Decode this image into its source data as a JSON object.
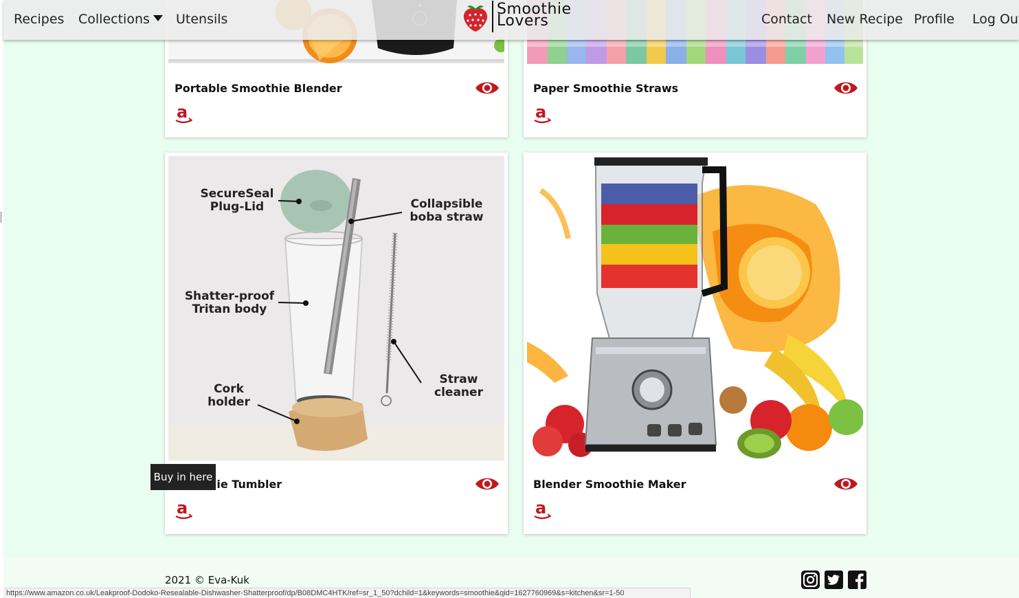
{
  "nav": {
    "left": [
      "Recipes",
      "Collections",
      "Utensils"
    ],
    "right": [
      "Contact",
      "New Recipe",
      "Profile",
      "Log Out"
    ]
  },
  "brand": {
    "line1": "Smoothie",
    "line2": "Lovers"
  },
  "cards": [
    {
      "title": "Portable Smoothie Blender"
    },
    {
      "title": "Paper Smoothie Straws"
    },
    {
      "title": "Smoothie Tumbler",
      "visible_title": "hie Tumbler"
    },
    {
      "title": "Blender Smoothie Maker"
    }
  ],
  "tumbler_callouts": {
    "lid": "SecureSeal\nPlug-Lid",
    "straw": "Collapsible\nboba straw",
    "body": "Shatter-proof\nTritan body",
    "cleaner": "Straw\ncleaner",
    "holder": "Cork\nholder"
  },
  "tooltip": "Buy in here",
  "footer": {
    "copyright": "2021 © Eva-Kuk"
  },
  "status_url": "https://www.amazon.co.uk/Leakproof-Dodoko-Resealable-Dishwasher-Shatterproof/dp/B08DMC4HTK/ref=sr_1_50?dchild=1&keywords=smoothie&qid=1627760969&s=kitchen&sr=1-50",
  "colors": {
    "accent": "#c0181f",
    "page_bg": "#e9fdf0"
  }
}
